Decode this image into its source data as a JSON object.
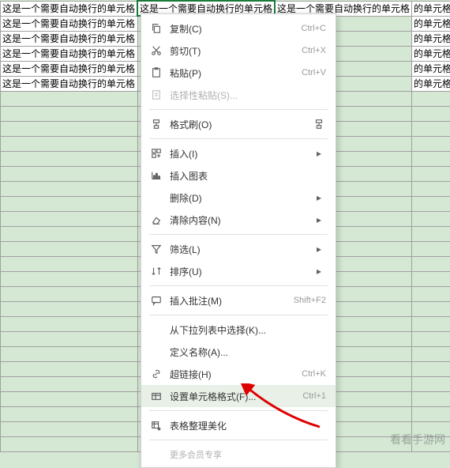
{
  "cell_text": "这是一个需要自动换行的单元格",
  "cell_text_right": "的单元格",
  "menu": {
    "copy": {
      "label": "复制(C)",
      "shortcut": "Ctrl+C"
    },
    "cut": {
      "label": "剪切(T)",
      "shortcut": "Ctrl+X"
    },
    "paste": {
      "label": "粘贴(P)",
      "shortcut": "Ctrl+V"
    },
    "pasteSpecial": {
      "label": "选择性粘贴(S)..."
    },
    "formatPainter": {
      "label": "格式刷(O)"
    },
    "insert": {
      "label": "插入(I)"
    },
    "insertChart": {
      "label": "插入图表"
    },
    "delete": {
      "label": "删除(D)"
    },
    "clearContents": {
      "label": "清除内容(N)"
    },
    "filter": {
      "label": "筛选(L)"
    },
    "sort": {
      "label": "排序(U)"
    },
    "insertComment": {
      "label": "插入批注(M)",
      "shortcut": "Shift+F2"
    },
    "pickFromList": {
      "label": "从下拉列表中选择(K)..."
    },
    "defineName": {
      "label": "定义名称(A)..."
    },
    "hyperlink": {
      "label": "超链接(H)",
      "shortcut": "Ctrl+K"
    },
    "formatCells": {
      "label": "设置单元格格式(F)...",
      "shortcut": "Ctrl+1"
    },
    "tableBeautify": {
      "label": "表格整理美化"
    },
    "moreVip": "更多会员专享"
  },
  "watermark": "看看手游网"
}
